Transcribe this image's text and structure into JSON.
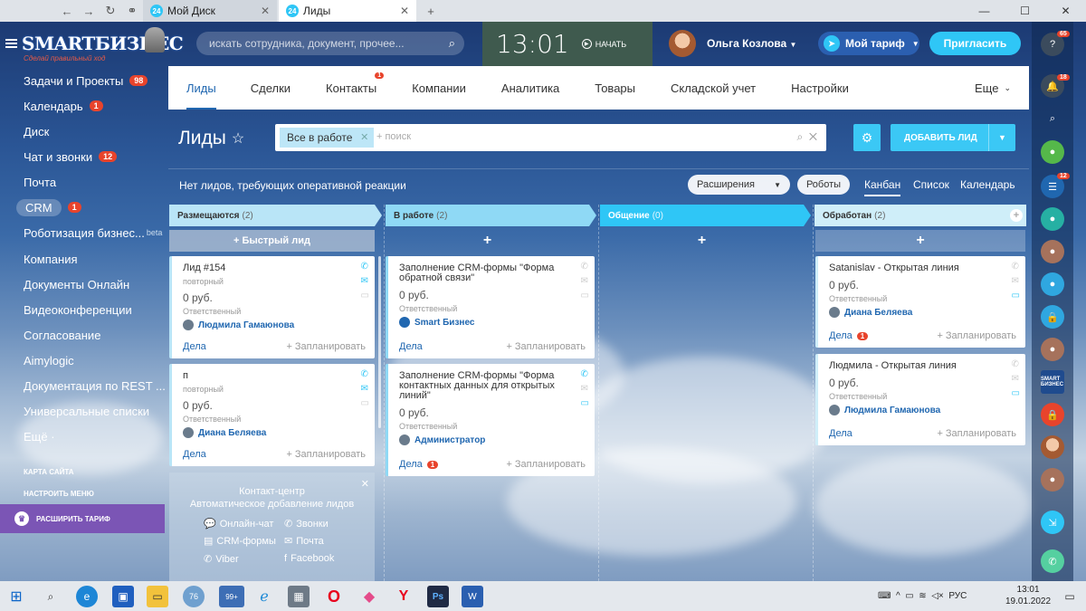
{
  "browser": {
    "tabs": [
      {
        "icon_text": "24",
        "label": "Мой Диск"
      },
      {
        "icon_text": "24",
        "label": "Лиды"
      }
    ],
    "new_tab": "+"
  },
  "sidebar": {
    "logo": "SMARTБИЗНЕС",
    "logo_sub": "Сделай правильный ход",
    "items": [
      {
        "label": "Задачи и Проекты",
        "count": "98"
      },
      {
        "label": "Календарь",
        "count": "1"
      },
      {
        "label": "Диск",
        "count": ""
      },
      {
        "label": "Чат и звонки",
        "count": "12"
      },
      {
        "label": "Почта",
        "count": ""
      },
      {
        "label": "CRM",
        "count": "1"
      },
      {
        "label": "Роботизация бизнес...",
        "count": "",
        "suffix": "beta"
      },
      {
        "label": "Компания",
        "count": ""
      },
      {
        "label": "Документы Онлайн",
        "count": ""
      },
      {
        "label": "Видеоконференции",
        "count": ""
      },
      {
        "label": "Согласование",
        "count": ""
      },
      {
        "label": "Aimylogic",
        "count": ""
      },
      {
        "label": "Документация по REST ...",
        "count": ""
      },
      {
        "label": "Универсальные списки",
        "count": ""
      },
      {
        "label": "Ещё ·",
        "count": ""
      }
    ],
    "sitemap": "КАРТА САЙТА",
    "setup_menu": "НАСТРОИТЬ МЕНЮ",
    "upgrade": "РАСШИРИТЬ ТАРИФ"
  },
  "header": {
    "search_placeholder": "искать сотрудника, документ, прочее...",
    "clock": "13:01",
    "start": "НАЧАТЬ",
    "user": "Ольга Козлова",
    "tariff": "Мой тариф",
    "invite": "Пригласить"
  },
  "right_rail": {
    "help_badge": "65",
    "bell_badge": "18",
    "chat_badge": "12",
    "logo_text": "SMART БИЗНЕС"
  },
  "crm_tabs": [
    {
      "label": "Лиды",
      "active": true
    },
    {
      "label": "Сделки"
    },
    {
      "label": "Контакты",
      "badge": "1"
    },
    {
      "label": "Компании"
    },
    {
      "label": "Аналитика"
    },
    {
      "label": "Товары"
    },
    {
      "label": "Складской учет"
    },
    {
      "label": "Настройки"
    },
    {
      "label": "Еще"
    }
  ],
  "page": {
    "title": "Лиды",
    "filter_chip": "Все в работе",
    "filter_search": "+ поиск",
    "add_lead": "ДОБАВИТЬ ЛИД",
    "no_leads": "Нет лидов, требующих оперативной реакции",
    "extensions": "Расширения",
    "robots": "Роботы",
    "views": [
      "Канбан",
      "Список",
      "Календарь"
    ]
  },
  "columns": [
    {
      "title": "Размещаются",
      "count": "(2)",
      "color": "#b9e5f7",
      "action": "+ Быстрый лид"
    },
    {
      "title": "В работе",
      "count": "(2)",
      "color": "#8fd9f5",
      "action": "+"
    },
    {
      "title": "Общение",
      "count": "(0)",
      "color": "#2fc6f6",
      "action": "+"
    },
    {
      "title": "Обработан",
      "count": "(2)",
      "color": "#cfeef9",
      "action": "+"
    }
  ],
  "cards": {
    "c1": {
      "title": "Лид #154",
      "sub": "повторный",
      "sum": "0 руб.",
      "resp": "Ответственный",
      "person": "Людмила Гамаюнова",
      "dela": "Дела",
      "plan": "+ Запланировать"
    },
    "c2": {
      "title": "п",
      "sub": "повторный",
      "sum": "0 руб.",
      "resp": "Ответственный",
      "person": "Диана Беляева",
      "dela": "Дела",
      "plan": "+ Запланировать"
    },
    "c3": {
      "title": "Заполнение CRM-формы \"Форма обратной связи\"",
      "sum": "0 руб.",
      "resp": "Ответственный",
      "person": "Smart Бизнес",
      "dela": "Дела",
      "plan": "+ Запланировать"
    },
    "c4": {
      "title": "Заполнение CRM-формы \"Форма контактных данных для открытых линий\"",
      "sum": "0 руб.",
      "resp": "Ответственный",
      "person": "Администратор",
      "dela": "Дела",
      "dela_badge": "1",
      "plan": "+ Запланировать"
    },
    "c5": {
      "title": "Satanislav - Открытая линия",
      "sum": "0 руб.",
      "resp": "Ответственный",
      "person": "Диана Беляева",
      "dela": "Дела",
      "dela_badge": "1",
      "plan": "+ Запланировать"
    },
    "c6": {
      "title": "Людмила - Открытая линия",
      "sum": "0 руб.",
      "resp": "Ответственный",
      "person": "Людмила Гамаюнова",
      "dela": "Дела",
      "plan": "+ Запланировать"
    }
  },
  "contact_center": {
    "title1": "Контакт-центр",
    "title2": "Автоматическое добавление лидов",
    "items": [
      "Онлайн-чат",
      "Звонки",
      "CRM-формы",
      "Почта",
      "Viber",
      "Facebook"
    ]
  },
  "taskbar": {
    "time": "13:01",
    "date": "19.01.2022",
    "lang": "РУС",
    "badge_76": "76",
    "badge_99": "99+"
  }
}
